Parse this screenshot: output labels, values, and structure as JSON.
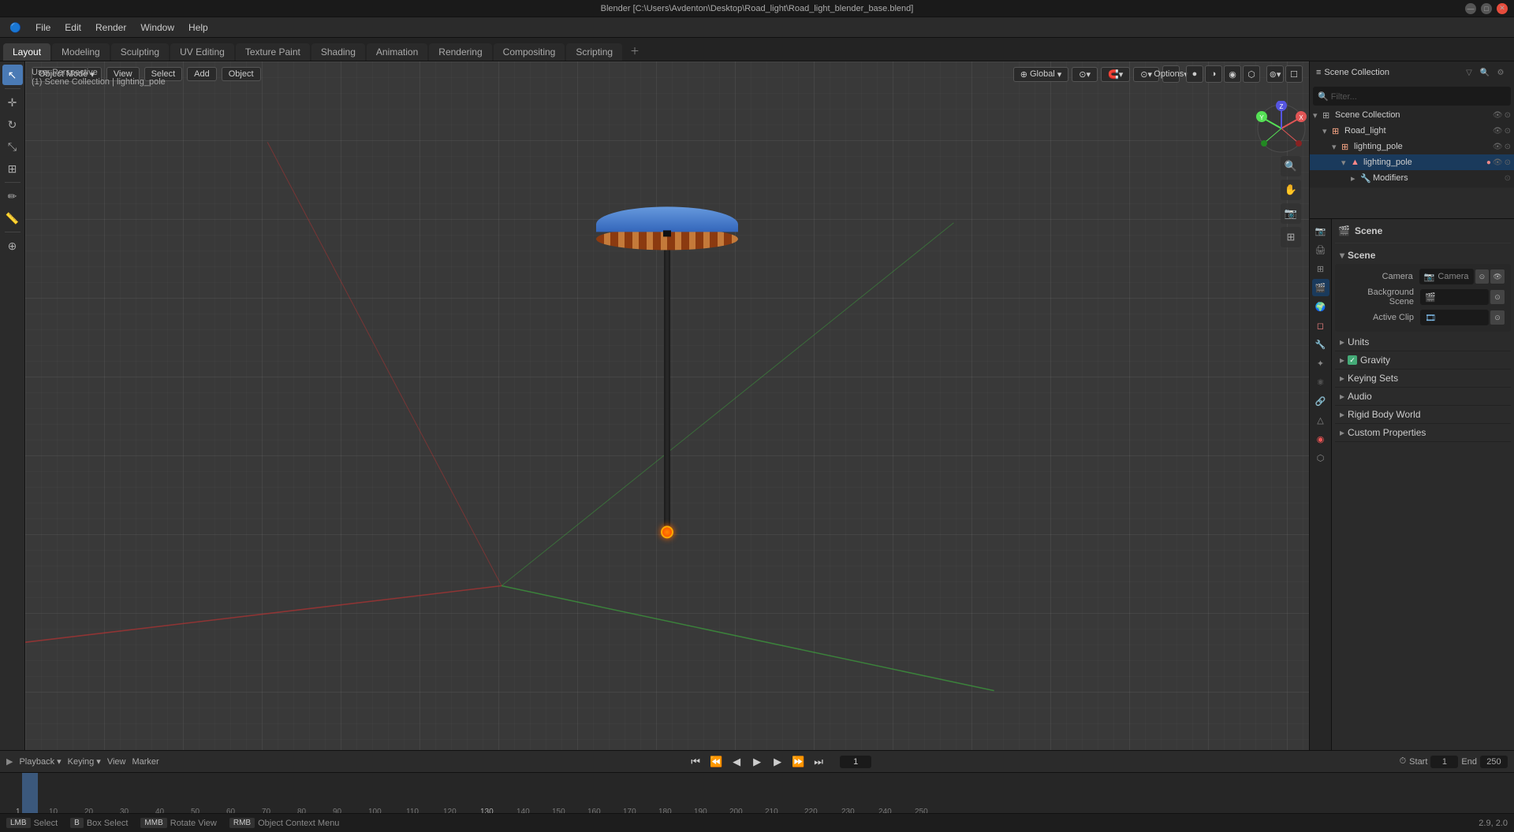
{
  "window": {
    "title": "Blender [C:\\Users\\Avdenton\\Desktop\\Road_light\\Road_light_blender_base.blend]",
    "min_btn": "—",
    "max_btn": "□",
    "close_btn": "✕"
  },
  "menu": {
    "items": [
      "Blender",
      "File",
      "Edit",
      "Render",
      "Window",
      "Help"
    ]
  },
  "workspace_tabs": {
    "tabs": [
      "Layout",
      "Modeling",
      "Sculpting",
      "UV Editing",
      "Texture Paint",
      "Shading",
      "Animation",
      "Rendering",
      "Compositing",
      "Scripting"
    ],
    "active": "Layout"
  },
  "viewport": {
    "mode": "Object Mode",
    "view_menu": "View",
    "select_menu": "Select",
    "add_menu": "Add",
    "object_menu": "Object",
    "transform_space": "Global",
    "label_perspective": "User Perspective",
    "label_collection": "(1) Scene Collection | lighting_pole",
    "options_btn": "Options"
  },
  "outliner": {
    "title": "Scene Collection",
    "items": [
      {
        "name": "Road_light",
        "type": "collection",
        "level": 1,
        "expanded": true
      },
      {
        "name": "lighting_pole",
        "type": "collection",
        "level": 2,
        "expanded": true
      },
      {
        "name": "lighting_pole",
        "type": "mesh",
        "level": 3,
        "expanded": false
      },
      {
        "name": "Modifiers",
        "type": "modifier",
        "level": 4,
        "expanded": false
      }
    ]
  },
  "properties": {
    "scene_section": {
      "label": "Scene",
      "camera_label": "Camera",
      "camera_value": "",
      "background_scene_label": "Background Scene",
      "active_clip_label": "Active Clip"
    },
    "sections_collapsed": [
      {
        "label": "Units"
      },
      {
        "label": "Gravity",
        "checked": true
      },
      {
        "label": "Keying Sets"
      },
      {
        "label": "Audio"
      },
      {
        "label": "Rigid Body World"
      },
      {
        "label": "Custom Properties"
      }
    ],
    "prop_icons": [
      "render",
      "output",
      "view_layer",
      "scene",
      "world",
      "object",
      "modifier",
      "particles",
      "physics",
      "constraints",
      "data",
      "material",
      "shader"
    ]
  },
  "timeline": {
    "playback_label": "Playback",
    "keying_label": "Keying",
    "view_label": "View",
    "marker_label": "Marker",
    "current_frame": "1",
    "start_label": "Start",
    "start_value": "1",
    "end_label": "End",
    "end_value": "250",
    "frame_markers": [
      "1",
      "10",
      "20",
      "30",
      "40",
      "50",
      "60",
      "70",
      "80",
      "90",
      "100",
      "110",
      "120",
      "130",
      "140",
      "150",
      "160",
      "170",
      "180",
      "190",
      "200",
      "210",
      "220",
      "230",
      "240",
      "250"
    ]
  },
  "status_bar": {
    "select_label": "Select",
    "select_key": "LMB",
    "box_select_label": "Box Select",
    "box_select_key": "B",
    "rotate_view_label": "Rotate View",
    "rotate_view_key": "MMB",
    "context_menu_label": "Object Context Menu",
    "context_menu_key": "RMB",
    "coords": "2.9, 2.0"
  }
}
